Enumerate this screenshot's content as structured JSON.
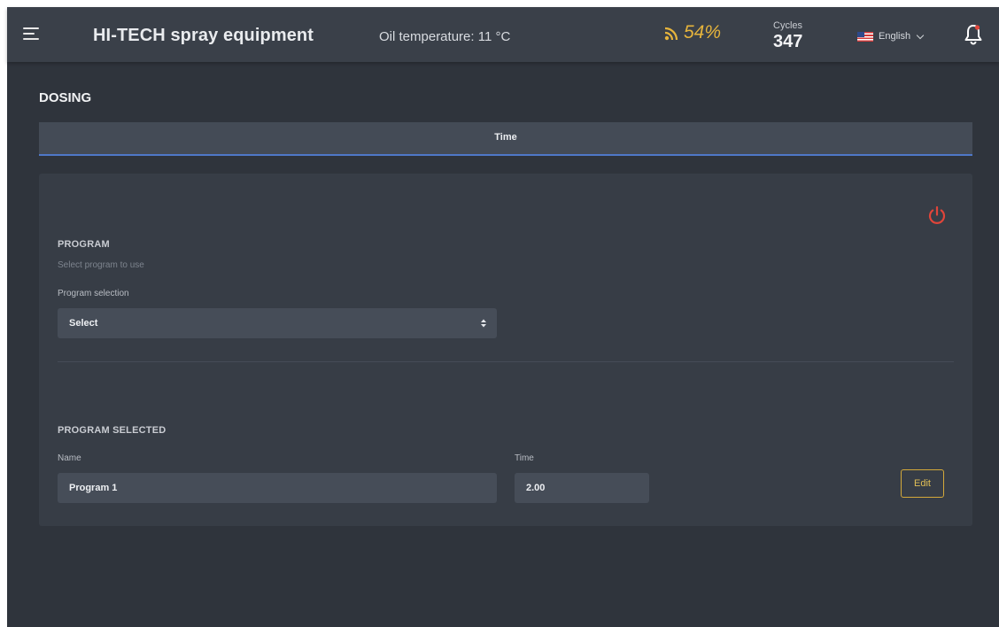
{
  "header": {
    "app_title": "HI-TECH spray equipment",
    "oil_temperature": "Oil temperature: 11 °C",
    "signal_value": "54%",
    "cycles_label": "Cycles",
    "cycles_value": "347",
    "language": "English"
  },
  "page": {
    "title": "DOSING"
  },
  "tabs": [
    {
      "label": "Time",
      "active": true
    }
  ],
  "program": {
    "section_title": "PROGRAM",
    "hint": "Select program to use",
    "selection_label": "Program selection",
    "selection_value": "Select"
  },
  "program_selected": {
    "section_title": "PROGRAM SELECTED",
    "name_label": "Name",
    "name_value": "Program 1",
    "time_label": "Time",
    "time_value": "2.00",
    "edit_label": "Edit"
  },
  "icons": {
    "menu": "hamburger-menu-icon",
    "signal": "wifi-signal-icon",
    "flag": "us-flag-icon",
    "dropdown": "chevron-down-icon",
    "notifications": "bell-icon",
    "power": "power-icon",
    "select_caret": "sort-caret-icon"
  },
  "colors": {
    "background": "#2f343c",
    "header": "#3a4049",
    "card": "#373d46",
    "field": "#464d58",
    "accent_yellow": "#e6b43c",
    "tab_underline": "#4f78c8",
    "power_red": "#e0453a",
    "edit_border": "#d4a93a"
  }
}
